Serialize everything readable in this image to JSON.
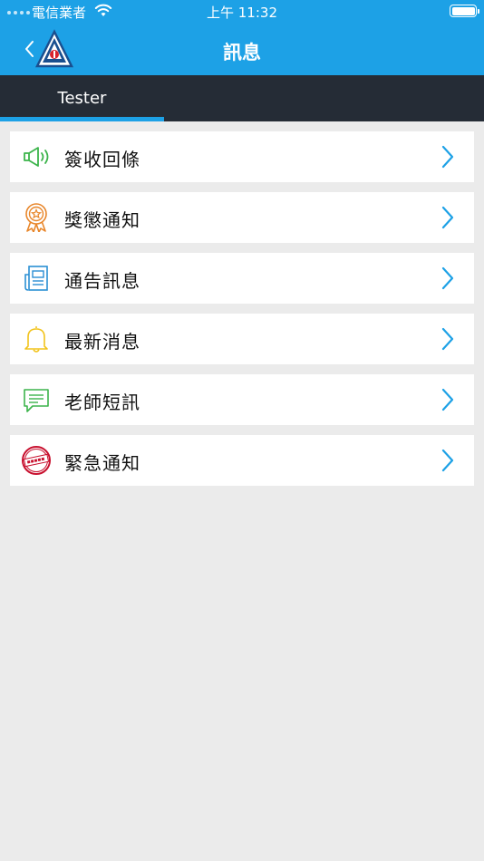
{
  "status_bar": {
    "carrier": "電信業者",
    "time": "上午 11:32"
  },
  "header": {
    "title": "訊息",
    "back_icon": "chevron-left-icon",
    "logo_icon": "school-logo-icon"
  },
  "tabs": [
    {
      "label": "Tester",
      "selected": true
    }
  ],
  "menu": {
    "items": [
      {
        "label": "簽收回條",
        "icon": "megaphone-icon",
        "color": "#3cb44b"
      },
      {
        "label": "獎懲通知",
        "icon": "award-ribbon-icon",
        "color": "#e8862a"
      },
      {
        "label": "通告訊息",
        "icon": "newspaper-icon",
        "color": "#2a8fd4"
      },
      {
        "label": "最新消息",
        "icon": "bell-icon",
        "color": "#f2c31b"
      },
      {
        "label": "老師短訊",
        "icon": "chat-bubble-icon",
        "color": "#3cb44b"
      },
      {
        "label": "緊急通知",
        "icon": "urgent-stamp-icon",
        "color": "#c8102e"
      }
    ]
  },
  "colors": {
    "accent": "#1da1e6",
    "tabbar": "#252c36",
    "background": "#ebebeb"
  }
}
